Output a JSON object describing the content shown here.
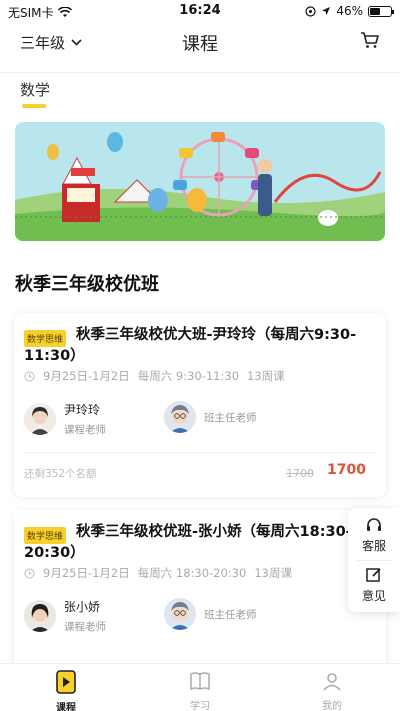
{
  "status_bar": {
    "carrier": "无SIM卡",
    "time": "16:24",
    "battery": "46%"
  },
  "nav": {
    "grade": "三年级",
    "title": "课程"
  },
  "tabs": [
    {
      "label": "数学"
    }
  ],
  "section_title": "秋季三年级校优班",
  "courses": [
    {
      "tag": "数学思维",
      "title": "秋季三年级校优大班-尹玲玲（每周六9:30-11:30）",
      "dates": "9月25日-1月2日",
      "schedule": "每周六 9:30-11:30",
      "lessons": "13周课",
      "teacher_name": "尹玲玲",
      "teacher_role": "课程老师",
      "headteacher_role": "班主任老师",
      "remain": "还剩352个名额",
      "old_price": "1700",
      "price": "1700"
    },
    {
      "tag": "数学思维",
      "title": "秋季三年级校优班-张小娇（每周六18:30-20:30）",
      "dates": "9月25日-1月2日",
      "schedule": "每周六 18:30-20:30",
      "lessons": "13周课",
      "teacher_name": "张小娇",
      "teacher_role": "课程老师",
      "headteacher_role": "班主任老师"
    }
  ],
  "side": {
    "service": "客服",
    "feedback": "意见"
  },
  "tabbar": {
    "course": "课程",
    "study": "学习",
    "mine": "我的"
  },
  "colors": {
    "accent": "#f7d12a",
    "price": "#e0503a"
  }
}
